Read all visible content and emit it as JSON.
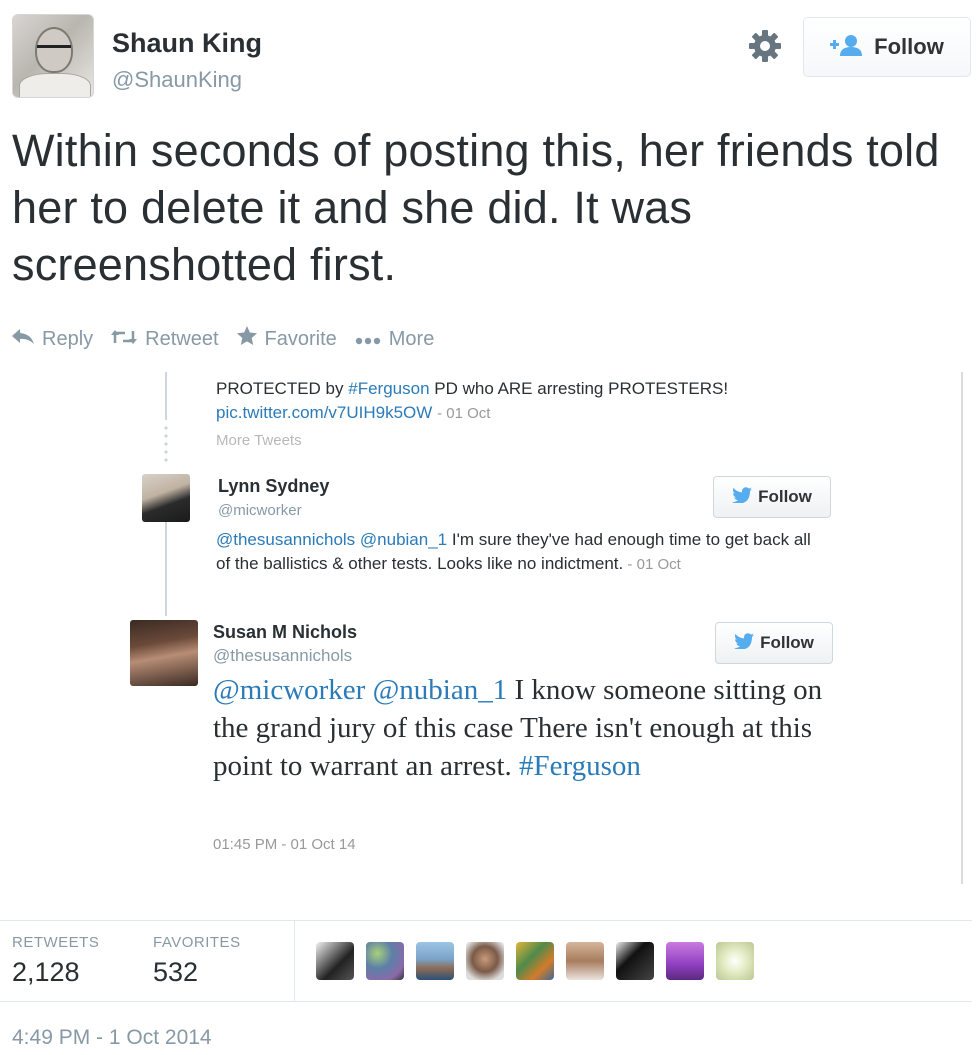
{
  "author": {
    "name": "Shaun King",
    "handle": "@ShaunKing"
  },
  "header": {
    "follow_label": "Follow"
  },
  "tweet": {
    "text": "Within seconds of posting this, her friends told her to delete it and she did. It was screenshotted first."
  },
  "actions": {
    "reply": "Reply",
    "retweet": "Retweet",
    "favorite": "Favorite",
    "more": "More"
  },
  "embedded": {
    "top_tweet": {
      "text_before": "PROTECTED by ",
      "hashtag": "#Ferguson",
      "text_after": " PD who ARE arresting PROTESTERS!",
      "link": "pic.twitter.com/v7UIH9k5OW",
      "date": "- 01 Oct",
      "more_tweets": "More Tweets"
    },
    "reply1": {
      "name": "Lynn Sydney",
      "handle": "@micworker",
      "follow_label": "Follow",
      "mention1": "@thesusannichols",
      "mention2": "@nubian_1",
      "text": " I'm sure they've had enough time to get back all of the ballistics & other tests. Looks like no indictment.",
      "date": " - 01 Oct"
    },
    "reply2": {
      "name": "Susan M Nichols",
      "handle": "@thesusannichols",
      "follow_label": "Follow",
      "mention1": "@micworker",
      "mention2": "@nubian_1",
      "text": " I know someone sitting on the grand jury of this case There isn't enough at this point to warrant an arrest. ",
      "hashtag": "#Ferguson",
      "timestamp": "01:45 PM - 01 Oct 14"
    }
  },
  "stats": {
    "retweets_label": "RETWEETS",
    "retweets_value": "2,128",
    "favorites_label": "FAVORITES",
    "favorites_value": "532"
  },
  "timestamp": "4:49 PM - 1 Oct 2014",
  "colors": {
    "link": "#2b7bb9",
    "muted": "#8899a6",
    "text": "#292f33",
    "twitter_bird": "#55acee"
  },
  "icons": [
    "gear-icon",
    "follow-person-icon",
    "reply-icon",
    "retweet-icon",
    "star-icon",
    "more-dots-icon",
    "twitter-bird-icon"
  ]
}
